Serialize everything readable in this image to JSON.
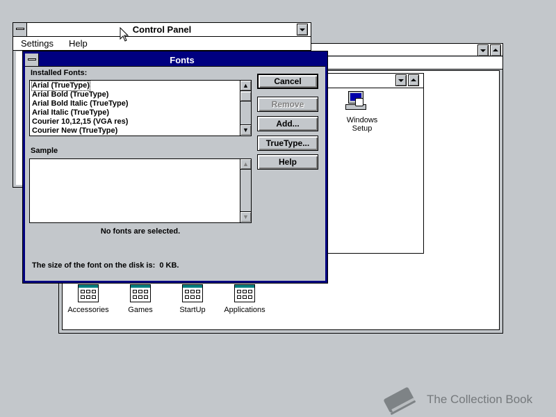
{
  "control_panel": {
    "title": "Control Panel",
    "menu": {
      "settings": "Settings",
      "help": "Help"
    }
  },
  "program_manager": {
    "inner_window_icon": {
      "label_line1": "Windows",
      "label_line2": "Setup"
    },
    "groups": [
      {
        "label": "Accessories"
      },
      {
        "label": "Games"
      },
      {
        "label": "StartUp"
      },
      {
        "label": "Applications"
      }
    ]
  },
  "fonts_dialog": {
    "title": "Fonts",
    "installed_label": "Installed Fonts:",
    "fonts": [
      "Arial (TrueType)",
      "Arial Bold (TrueType)",
      "Arial Bold Italic (TrueType)",
      "Arial Italic (TrueType)",
      "Courier 10,12,15 (VGA res)",
      "Courier New (TrueType)"
    ],
    "selected_index": 0,
    "sample_label": "Sample",
    "no_selection_text": "No fonts are selected.",
    "size_text": "The size of the font on the disk is:  0 KB.",
    "buttons": {
      "cancel": "Cancel",
      "remove": "Remove",
      "add": "Add...",
      "truetype": "TrueType...",
      "help": "Help"
    }
  },
  "watermark": {
    "text": "The Collection Book"
  },
  "colors": {
    "desktop": "#c3c7cb",
    "active_title": "#000080",
    "accent_teal": "#008080"
  }
}
